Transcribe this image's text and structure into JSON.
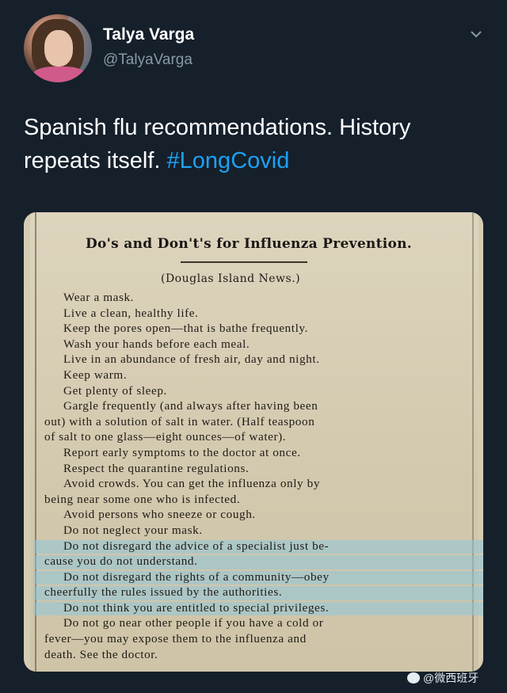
{
  "tweet": {
    "author_name": "Talya Varga",
    "author_handle": "@TalyaVarga",
    "text_main": "Spanish flu recommendations. History repeats itself.",
    "hashtag": "#LongCovid"
  },
  "clipping": {
    "title": "Do's and Don't's for Influenza Prevention.",
    "source": "(Douglas Island News.)",
    "lines": [
      "Wear a mask.",
      "Live a clean, healthy life.",
      "Keep the pores open—that is bathe frequently.",
      "Wash your hands before each meal.",
      "Live in an abundance of fresh air, day and night.",
      "Keep warm.",
      "Get plenty of sleep.",
      "Gargle frequently (and always after having been",
      "out) with a solution of salt in water. (Half teaspoon",
      "of salt to one glass—eight ounces—of water).",
      "Report early symptoms to the doctor at once.",
      "Respect the quarantine regulations.",
      "Avoid crowds. You can get the influenza only by",
      "being near some one who is infected.",
      "Avoid persons who sneeze or cough.",
      "Do not neglect your mask.",
      "Do not disregard the advice of a specialist just be-",
      "cause you do not understand.",
      "Do not disregard the rights of a community—obey",
      "cheerfully the rules issued by the authorities.",
      "Do not think you are entitled to special privileges.",
      "Do not go near other people if you have a cold or",
      "fever—you may expose them to the influenza and",
      "death. See the doctor."
    ]
  },
  "watermark": {
    "text": "@微西班牙"
  },
  "colors": {
    "background": "#15202b",
    "hashtag": "#1da1f2",
    "handle": "#8899a6",
    "highlight": "#8ec6dd"
  }
}
